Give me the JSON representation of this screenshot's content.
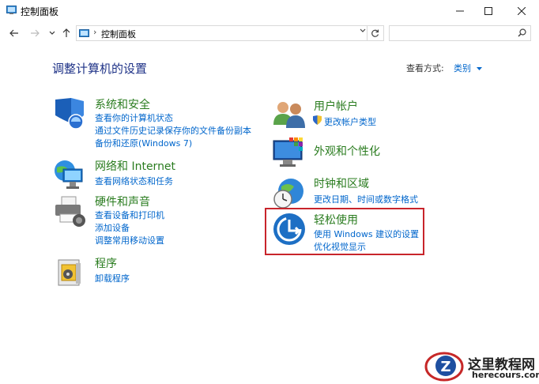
{
  "window": {
    "title": "控制面板"
  },
  "address": {
    "crumb": "控制面板"
  },
  "search": {
    "placeholder": ""
  },
  "page": {
    "heading": "调整计算机的设置",
    "view_by_label": "查看方式:",
    "view_by_value": "类别"
  },
  "categories": [
    {
      "title": "系统和安全",
      "links": [
        "查看你的计算机状态",
        "通过文件历史记录保存你的文件备份副本",
        "备份和还原(Windows 7)"
      ]
    },
    {
      "title": "网络和 Internet",
      "links": [
        "查看网络状态和任务"
      ]
    },
    {
      "title": "硬件和声音",
      "links": [
        "查看设备和打印机",
        "添加设备",
        "调整常用移动设置"
      ]
    },
    {
      "title": "程序",
      "links": [
        "卸载程序"
      ]
    },
    {
      "title": "用户帐户",
      "links": [
        "更改帐户类型"
      ]
    },
    {
      "title": "外观和个性化",
      "links": []
    },
    {
      "title": "时钟和区域",
      "links": [
        "更改日期、时间或数字格式"
      ]
    },
    {
      "title": "轻松使用",
      "links": [
        "使用 Windows 建议的设置",
        "优化视觉显示"
      ]
    }
  ],
  "watermark": {
    "text": "这里教程网",
    "url": "herecours.com"
  },
  "colors": {
    "heading": "#1e3287",
    "category": "#2a7c1f",
    "link": "#0066cc",
    "highlight": "#c8242b"
  }
}
